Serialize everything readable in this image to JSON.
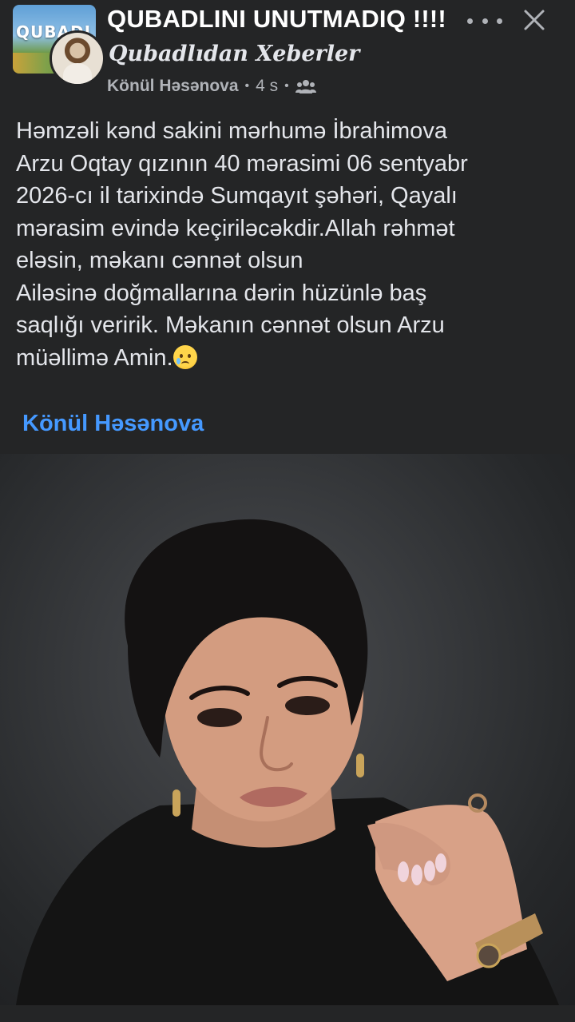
{
  "header": {
    "group_name": "QUBADLINI UNUTMADIQ !!!!",
    "subtitle": "Qubadlıdan Xeberler",
    "author": "Könül Həsənova",
    "time": "4 s",
    "separator": "•",
    "avatar_sign": "QUBADLI",
    "icons": {
      "more": "more-options-icon",
      "close": "close-icon",
      "audience": "members-icon"
    }
  },
  "post": {
    "text": "Həmzəli kənd sakini mərhumə İbrahimova\nArzu Oqtay qızının 40 mərasimi 06 sentyabr\n2026-cı il tarixində Sumqayıt şəhəri, Qayalı\nmərasim evində keçiriləcəkdir.Allah rəhmət\neləsin, məkanı cənnət olsun\nAiləsinə doğmallarına dərin hüzünlə baş\nsaqlığı veririk. Məkanın cənnət olsun Arzu\nmüəllimə Amin.",
    "emoji": "sad-tear-emoji",
    "tagged_user": "Könül Həsənova"
  },
  "colors": {
    "background": "#242526",
    "text": "#e4e6eb",
    "secondary_text": "#b0b3b8",
    "link": "#4599ff"
  }
}
